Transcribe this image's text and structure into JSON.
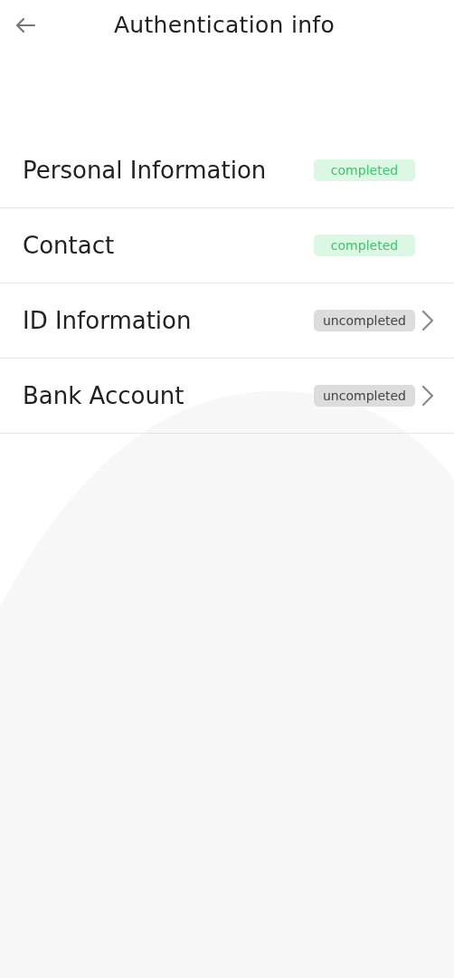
{
  "header": {
    "title": "Authentication info"
  },
  "items": [
    {
      "label": "Personal Information",
      "status": "completed",
      "kind": "done"
    },
    {
      "label": "Contact",
      "status": "completed",
      "kind": "done"
    },
    {
      "label": "ID Information",
      "status": "uncompleted",
      "kind": "pending"
    },
    {
      "label": "Bank Account",
      "status": "uncompleted",
      "kind": "pending"
    }
  ]
}
